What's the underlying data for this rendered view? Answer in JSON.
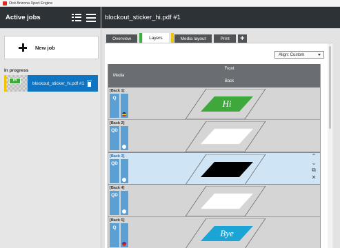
{
  "os_window": {
    "title": "Océ Arizona Xpert Engine"
  },
  "left_panel": {
    "title": "Active jobs",
    "new_job_label": "New job",
    "section_label": "In progress",
    "jobs": [
      {
        "name": "blockout_sticker_hi.pdf #1",
        "thumb_text": "Hi"
      }
    ]
  },
  "right_panel": {
    "title": "blockout_sticker_hi.pdf #1",
    "tabs": [
      {
        "label": "Overview",
        "active": false
      },
      {
        "label": "Layers",
        "active": true
      },
      {
        "label": "Media layout",
        "active": false
      },
      {
        "label": "Print",
        "active": false
      }
    ],
    "add_tab_symbol": "+",
    "align_select": {
      "value": "Align: Custom"
    },
    "grid": {
      "col_media": "Media",
      "col_front": "Front",
      "col_back": "Back",
      "rows": [
        {
          "label": "[Back 1]",
          "ink": "Q",
          "selected": false,
          "art": "green",
          "art_text": "Hi"
        },
        {
          "label": "[Back 2]",
          "ink": "QD",
          "selected": false,
          "art": "white",
          "art_text": ""
        },
        {
          "label": "[Back 3]",
          "ink": "QD",
          "selected": true,
          "art": "black",
          "art_text": ""
        },
        {
          "label": "[Back 4]",
          "ink": "QD",
          "selected": false,
          "art": "white",
          "art_text": ""
        },
        {
          "label": "[Back 5]",
          "ink": "Q",
          "selected": false,
          "art": "blue",
          "art_text": "Bye"
        }
      ]
    },
    "row_actions": {
      "up": "⌃",
      "down": "⌄",
      "copy": "⧉",
      "delete": "✕"
    }
  },
  "colors": {
    "header_bg": "#2d3237",
    "selection_blue": "#0f74c2",
    "ink_blue": "#5b9fd3",
    "green_art": "#3ea83b",
    "blue_art": "#1aa5d6",
    "tab_marker_green": "#3bb03a",
    "tab_marker_yellow": "#f2c400"
  }
}
